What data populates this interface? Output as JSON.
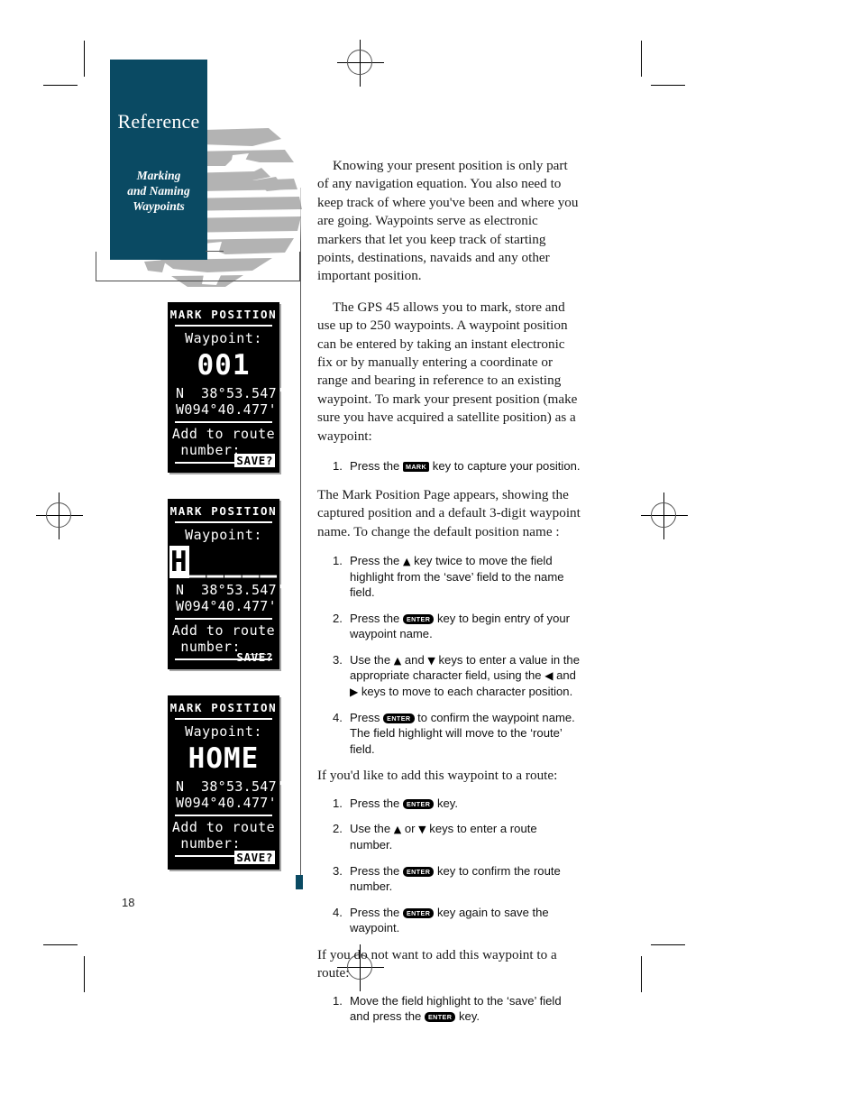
{
  "masthead": {
    "section_title": "Reference",
    "subtitle_lines": [
      "Marking",
      "and Naming",
      "Waypoints"
    ],
    "accent_color": "#0a4a63"
  },
  "page_number": "18",
  "body": {
    "paragraph_1": "Knowing your present position is only part of any navigation equation. You also need to keep track of where you've been and where you are going. Waypoints serve as electronic markers that let you keep track of starting points, destinations, navaids and any other important position.",
    "paragraph_2": "The GPS 45 allows you to mark, store and use up to 250 waypoints. A waypoint position can be entered by taking an instant electronic fix or by manually entering a coordinate or range and bearing in reference to an existing waypoint. To mark your present position (make sure you have acquired a satellite position) as a waypoint:",
    "paragraph_3": "The Mark Position Page appears, showing the captured position and a default 3-digit waypoint name. To change the default position name :",
    "lead_add_route": "If you'd like to add this waypoint to a route:",
    "lead_no_route": "If you do not want to add this waypoint to a route:"
  },
  "keys": {
    "mark": "MARK",
    "enter": "ENTER",
    "up": "▲",
    "down": "▼",
    "left": "◀",
    "right": "▶"
  },
  "steps_capture": [
    {
      "num": "1.",
      "before": "Press the",
      "key": "MARK",
      "after": "key to capture your position."
    }
  ],
  "steps_name": [
    {
      "num": "1.",
      "before": "Press the",
      "key": "▲",
      "after": "key twice to move the field highlight from the ‘save’ field to the name field."
    },
    {
      "num": "2.",
      "before": "Press the",
      "key": "ENTER",
      "after": "key to begin entry of your waypoint name."
    },
    {
      "num": "3.",
      "before": "Use the",
      "key": "▲",
      "mid1": "and",
      "key2": "▼",
      "mid2": "keys to enter a value in the appropriate character field, using the",
      "key3": "◀",
      "mid3": "and",
      "key4": "▶",
      "after": "keys to move to each character position."
    },
    {
      "num": "4.",
      "before": "Press",
      "key": "ENTER",
      "after": "to confirm the waypoint name. The field highlight will move to the ‘route’ field."
    }
  ],
  "steps_route": [
    {
      "num": "1.",
      "before": "Press the",
      "key": "ENTER",
      "after": "key."
    },
    {
      "num": "2.",
      "before": "Use the",
      "key": "▲",
      "mid1": "or",
      "key2": "▼",
      "after": "keys to enter a route number."
    },
    {
      "num": "3.",
      "before": "Press the",
      "key": "ENTER",
      "after": "key to confirm the route number."
    },
    {
      "num": "4.",
      "before": "Press the",
      "key": "ENTER",
      "after": "key again to save the waypoint."
    }
  ],
  "steps_norest": [
    {
      "num": "1.",
      "before": "Move the field highlight to the ‘save’ field and press the",
      "key": "ENTER",
      "after": "key."
    }
  ],
  "gps_screens": [
    {
      "header": "MARK POSITION",
      "field_label": "Waypoint:",
      "waypoint_name": "001",
      "waypoint_highlight": "",
      "waypoint_rest": "",
      "lat": "N  38°53.547'",
      "lon": "W094°40.477'",
      "route_line1": "Add to route",
      "route_line2": "number: __",
      "save_label": "SAVE?",
      "save_highlighted": true
    },
    {
      "header": "MARK POSITION",
      "field_label": "Waypoint:",
      "waypoint_name": "H_____",
      "waypoint_highlight": "H",
      "waypoint_rest": "_____",
      "lat": "N  38°53.547'",
      "lon": "W094°40.477'",
      "route_line1": "Add to route",
      "route_line2": "number: __",
      "save_label": "SAVE?",
      "save_highlighted": false
    },
    {
      "header": "MARK POSITION",
      "field_label": "Waypoint:",
      "waypoint_name": "HOME",
      "waypoint_highlight": "",
      "waypoint_rest": "",
      "lat": "N  38°53.547'",
      "lon": "W094°40.477'",
      "route_line1": "Add to route",
      "route_line2": "number: __",
      "save_label": "SAVE?",
      "save_highlighted": true
    }
  ]
}
